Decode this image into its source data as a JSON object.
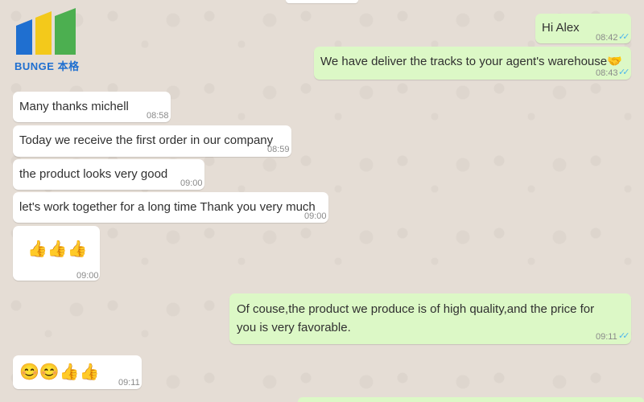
{
  "logo": {
    "name": "BUNGE",
    "chinese": "本格",
    "bar_colors": [
      "#1f6fd0",
      "#f3c91b",
      "#4caf50"
    ]
  },
  "colors": {
    "chat_background": "#e5ddd5",
    "incoming_bubble": "#ffffff",
    "outgoing_bubble": "#dcf8c6",
    "read_ticks": "#4fb6ec"
  },
  "messages": [
    {
      "direction": "outgoing",
      "text": "Hi Alex",
      "time": "08:42",
      "status": "read-double-check-icon"
    },
    {
      "direction": "outgoing",
      "text": "We have deliver the tracks to your agent's warehouse",
      "emoji": "🤝",
      "time": "08:43",
      "status": "read-double-check-icon"
    },
    {
      "direction": "incoming",
      "text": "Many thanks michell",
      "time": "08:58"
    },
    {
      "direction": "incoming",
      "text": "Today we receive the first order in our company",
      "time": "08:59"
    },
    {
      "direction": "incoming",
      "text": "the product looks very good",
      "time": "09:00"
    },
    {
      "direction": "incoming",
      "text": "let's work together for a long time Thank you very much",
      "time": "09:00"
    },
    {
      "direction": "incoming",
      "emoji": "👍👍👍",
      "time": "09:00"
    },
    {
      "direction": "outgoing",
      "text": "Of couse,the product we produce is of high quality,and the price for you is very favorable.",
      "time": "09:11",
      "status": "read-double-check-icon"
    },
    {
      "direction": "incoming",
      "emoji": "😊😊👍👍",
      "time": "09:11"
    }
  ]
}
